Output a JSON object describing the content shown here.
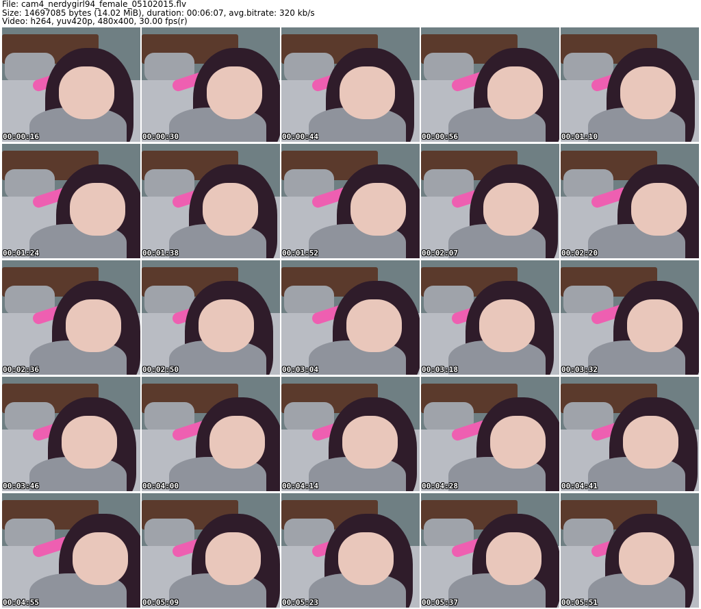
{
  "header": {
    "line1": "File: cam4_nerdygirl94_female_05102015.flv",
    "line2": "Size: 14697085 bytes (14.02 MiB), duration: 00:06:07, avg.bitrate: 320 kb/s",
    "line3": "Video: h264, yuv420p, 480x400, 30.00 fps(r)"
  },
  "thumbnails": [
    {
      "timestamp": "00:00:16"
    },
    {
      "timestamp": "00:00:30"
    },
    {
      "timestamp": "00:00:44"
    },
    {
      "timestamp": "00:00:56"
    },
    {
      "timestamp": "00:01:10"
    },
    {
      "timestamp": "00:01:24"
    },
    {
      "timestamp": "00:01:38"
    },
    {
      "timestamp": "00:01:52"
    },
    {
      "timestamp": "00:02:07"
    },
    {
      "timestamp": "00:02:20"
    },
    {
      "timestamp": "00:02:36"
    },
    {
      "timestamp": "00:02:50"
    },
    {
      "timestamp": "00:03:04"
    },
    {
      "timestamp": "00:03:18"
    },
    {
      "timestamp": "00:03:32"
    },
    {
      "timestamp": "00:03:46"
    },
    {
      "timestamp": "00:04:00"
    },
    {
      "timestamp": "00:04:14"
    },
    {
      "timestamp": "00:04:28"
    },
    {
      "timestamp": "00:04:41"
    },
    {
      "timestamp": "00:04:55"
    },
    {
      "timestamp": "00:05:09"
    },
    {
      "timestamp": "00:05:23"
    },
    {
      "timestamp": "00:05:37"
    },
    {
      "timestamp": "00:05:51"
    }
  ]
}
